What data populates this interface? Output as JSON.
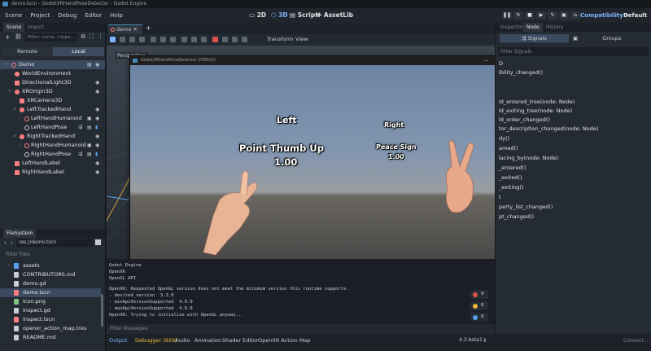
{
  "window": {
    "title": "demo.tscn - GodotXRHandPoseDetector - Godot Engine"
  },
  "menu": [
    "Scene",
    "Project",
    "Debug",
    "Editor",
    "Help"
  ],
  "workspaces": {
    "two_d": "2D",
    "three_d": "3D",
    "script": "Script",
    "assetlib": "AssetLib"
  },
  "renderer": {
    "compat": "Compatibility ▾",
    "default": "Default ▾"
  },
  "scene_dock": {
    "tabs": [
      "Scene",
      "Import"
    ],
    "filter_placeholder": "Filter: name, t:type,...",
    "modes": [
      "Remote",
      "Local"
    ],
    "tree": [
      {
        "label": "Demo"
      },
      {
        "label": "WorldEnvironment"
      },
      {
        "label": "DirectionalLight3D"
      },
      {
        "label": "XROrigin3D"
      },
      {
        "label": "XRCamera3D"
      },
      {
        "label": "LeftTrackedHand"
      },
      {
        "label": "LeftHandHumanoid"
      },
      {
        "label": "LeftHandPose"
      },
      {
        "label": "RightTrackedHand"
      },
      {
        "label": "RightHandHumanoid"
      },
      {
        "label": "RightHandPose"
      },
      {
        "label": "LeftHandLabel"
      },
      {
        "label": "RightHandLabel"
      }
    ]
  },
  "filesystem": {
    "tab": "FileSystem",
    "path": "res://demo.tscn",
    "filter_placeholder": "Filter Files",
    "items": [
      {
        "label": "assets"
      },
      {
        "label": "CONTRIBUTORS.md"
      },
      {
        "label": "demo.gd"
      },
      {
        "label": "demo.tscn"
      },
      {
        "label": "icon.png"
      },
      {
        "label": "inspect.gd"
      },
      {
        "label": "inspect.tscn"
      },
      {
        "label": "openxr_action_map.tres"
      },
      {
        "label": "README.md"
      }
    ]
  },
  "viewport": {
    "tab": "demo",
    "menus": {
      "transform": "Transform",
      "view": "View"
    },
    "persp": "Perspective"
  },
  "game": {
    "title": "GodotXRHandPoseDetector (DEBUG)",
    "left_label": "Left",
    "left_pose": "Point Thumb Up",
    "left_value": "1.00",
    "right_label": "Right",
    "right_pose": "Peace Sign",
    "right_value": "1.00"
  },
  "console": {
    "lines": [
      "Godot Engine",
      "OpenXR",
      "OpenGL API",
      "",
      "OpenXR: Requested OpenGL version does not meet the minimum version this runtime supports.",
      "- desired_version  3.3.0",
      "- minApiVersionSupported  4.0.0",
      "- maxApiVersionSupported  4.6.0",
      "OpenXR: Trying to initialize with OpenGL anyway..."
    ],
    "counts": {
      "errors": "9",
      "warnings": "0",
      "messages": "0"
    },
    "filter_placeholder": "Filter Messages"
  },
  "bottom_tabs": [
    "Output",
    "Debugger (929)",
    "Audio",
    "Animation",
    "Shader Editor",
    "OpenXR Action Map"
  ],
  "version": "4.3.beta1",
  "right_dock": {
    "tabs": [
      "Inspector",
      "Node",
      "History"
    ],
    "subtabs": {
      "signals": "Signals",
      "groups": "Groups"
    },
    "filter_placeholder": "Filter Signals",
    "signals": [
      "D",
      "ibility_changed()",
      "",
      "ld_entered_tree(node: Node)",
      "ld_exiting_tree(node: Node)",
      "ld_order_changed()",
      "tor_description_changed(node: Node)",
      "dy()",
      "amed()",
      "lacing_by(node: Node)",
      "_entered()",
      "_exited()",
      "_exiting()",
      "t",
      "perty_list_changed()",
      "pt_changed()"
    ]
  },
  "colors": {
    "accent": "#478cbf",
    "selection": "#3b4a5e",
    "error": "#e0524b",
    "warning": "#f0b53a"
  }
}
